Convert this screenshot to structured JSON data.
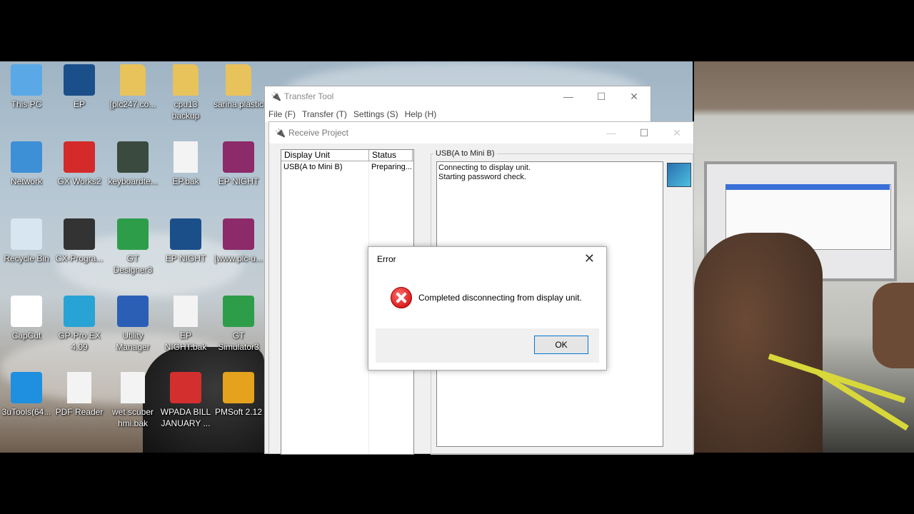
{
  "desktop": {
    "icons": [
      {
        "label": "This PC",
        "icon": "computer-icon",
        "color": "#5aa9e6"
      },
      {
        "label": "EP",
        "icon": "pmsoft-icon",
        "color": "#1b4f8a"
      },
      {
        "label": "[plc247.co...",
        "icon": "folder-icon",
        "color": "#e8c25a"
      },
      {
        "label": "cpu13 backup",
        "icon": "folder-icon",
        "color": "#e8c25a"
      },
      {
        "label": "sarina plastic",
        "icon": "folder-icon",
        "color": "#e8c25a"
      },
      {
        "label": "Network",
        "icon": "network-icon",
        "color": "#3d8fd6"
      },
      {
        "label": "GX Works2",
        "icon": "gxworks-icon",
        "color": "#d42a2a"
      },
      {
        "label": "keyboardte...",
        "icon": "test-icon",
        "color": "#3b4a3f"
      },
      {
        "label": "EP.bak",
        "icon": "file-icon",
        "color": "#f3f3f3"
      },
      {
        "label": "EP NIGHT",
        "icon": "winrar-icon",
        "color": "#8c2a6a"
      },
      {
        "label": "Recycle Bin",
        "icon": "recycle-bin-icon",
        "color": "#d7e6f0"
      },
      {
        "label": "CX-Progra...",
        "icon": "cx-programmer-icon",
        "color": "#333"
      },
      {
        "label": "GT Designer3",
        "icon": "gtdesigner-icon",
        "color": "#2e9d4a"
      },
      {
        "label": "EP NIGHT",
        "icon": "pmsoft-icon",
        "color": "#1b4f8a"
      },
      {
        "label": "[www.plc-u...",
        "icon": "winrar-icon",
        "color": "#8c2a6a"
      },
      {
        "label": "CapCut",
        "icon": "capcut-icon",
        "color": "#fff"
      },
      {
        "label": "GP-Pro EX 4.09",
        "icon": "gppro-icon",
        "color": "#29a3d6"
      },
      {
        "label": "Utility Manager",
        "icon": "utility-manager-icon",
        "color": "#2b5fb5"
      },
      {
        "label": "EP NIGHT.bak",
        "icon": "file-icon",
        "color": "#f3f3f3"
      },
      {
        "label": "GT Simulator3",
        "icon": "gtsimulator-icon",
        "color": "#2e9d4a"
      },
      {
        "label": "3uTools(64...",
        "icon": "3utools-icon",
        "color": "#1f8fe0"
      },
      {
        "label": "PDF Reader",
        "icon": "file-icon",
        "color": "#f3f3f3"
      },
      {
        "label": "wet scuber hmi.bak",
        "icon": "file-icon",
        "color": "#f3f3f3"
      },
      {
        "label": "WPADA BILL JANUARY ...",
        "icon": "pdf-icon",
        "color": "#d32f2f"
      },
      {
        "label": "PMSoft 2.12",
        "icon": "pmsoft2-icon",
        "color": "#e5a21c"
      }
    ]
  },
  "transfer_tool": {
    "title": "Transfer Tool",
    "menu": [
      "File (F)",
      "Transfer (T)",
      "Settings (S)",
      "Help (H)"
    ]
  },
  "receive_project": {
    "title": "Receive Project",
    "columns": [
      "Display Unit",
      "Status"
    ],
    "rows": [
      {
        "unit": "USB(A to Mini B)",
        "status": "Preparing..."
      }
    ],
    "group_label": "USB(A to Mini B)",
    "log": [
      "Connecting to display unit.",
      "Starting password check."
    ]
  },
  "error_dialog": {
    "title": "Error",
    "message": "Completed disconnecting from display unit.",
    "ok_label": "OK",
    "close_glyph": "✕"
  },
  "window_controls": {
    "minimize": "—",
    "maximize": "☐",
    "close": "✕"
  }
}
